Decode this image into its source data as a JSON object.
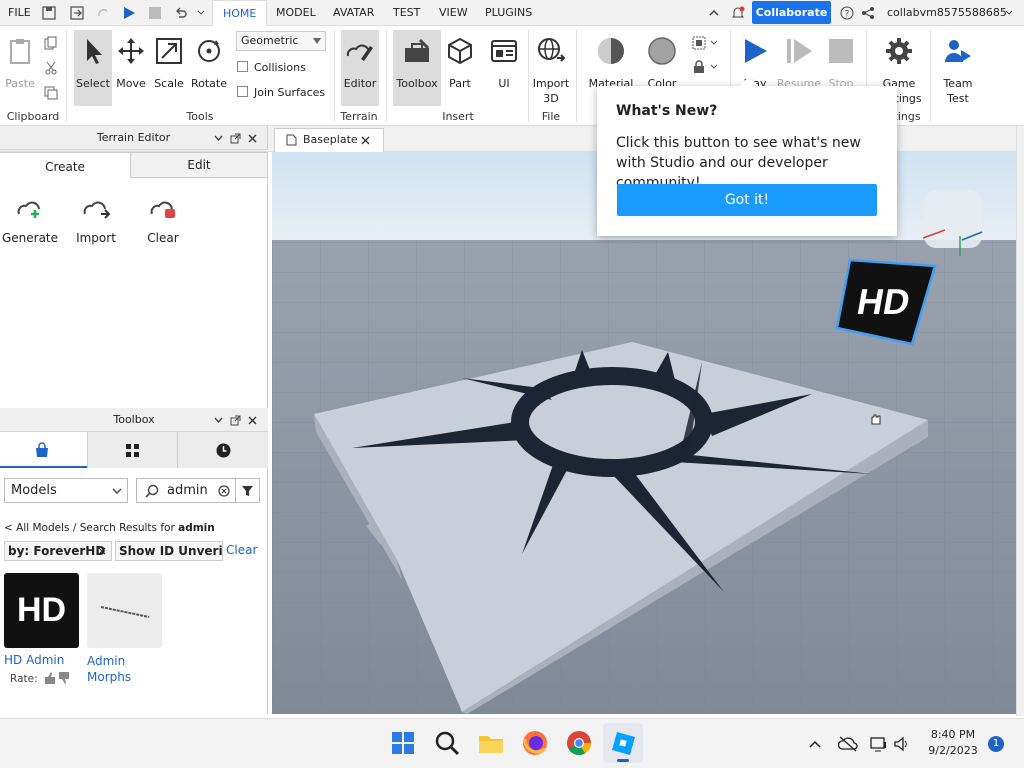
{
  "menubar": {
    "file": "FILE",
    "tabs": [
      "HOME",
      "MODEL",
      "AVATAR",
      "TEST",
      "VIEW",
      "PLUGINS"
    ],
    "collaborate": "Collaborate",
    "username": "collabvm8575588685"
  },
  "ribbon": {
    "paste": "Paste",
    "select": "Select",
    "move": "Move",
    "scale": "Scale",
    "rotate": "Rotate",
    "mode_value": "Geometric",
    "collisions": "Collisions",
    "join_surfaces": "Join Surfaces",
    "editor": "Editor",
    "toolbox": "Toolbox",
    "part": "Part",
    "ui": "UI",
    "import3d_1": "Import",
    "import3d_2": "3D",
    "material": "Material",
    "color": "Color",
    "play": "Play",
    "resume": "Resume",
    "stop": "Stop",
    "game1": "Game",
    "game2": "Settings",
    "team1": "Team",
    "team2": "Test",
    "groups": {
      "clipboard": "Clipboard",
      "tools": "Tools",
      "terrain": "Terrain",
      "insert": "Insert",
      "file": "File",
      "settings": "Settings"
    }
  },
  "terrain_editor": {
    "title": "Terrain Editor",
    "tabs": [
      "Create",
      "Edit"
    ],
    "tools": [
      "Generate",
      "Import",
      "Clear"
    ]
  },
  "doc_tab": {
    "label": "Baseplate"
  },
  "toolbox": {
    "title": "Toolbox",
    "category": "Models",
    "search_value": "admin",
    "breadcrumb_prefix": "< All Models / Search Results for ",
    "breadcrumb_query": "admin",
    "chip1": "by: ForeverHD",
    "chip2": "Show ID Unverifi",
    "clear": "Clear",
    "results": [
      {
        "name": "HD Admin",
        "thumb": "HD"
      },
      {
        "name": "Admin Morphs"
      }
    ],
    "rate": "Rate:"
  },
  "popup": {
    "title": "What's New?",
    "body": "Click this button to see what's new with Studio and our developer community!",
    "button": "Got it!"
  },
  "viewport": {
    "hd_label": "HD"
  },
  "taskbar": {
    "time": "8:40 PM",
    "date": "9/2/2023",
    "notif": "1"
  },
  "colors": {
    "accent": "#1e64c8",
    "collaborate": "#1a73e8",
    "gotit": "#1a9cff",
    "sky_top": "#dfe8f2",
    "floor": "#8d97a5"
  }
}
